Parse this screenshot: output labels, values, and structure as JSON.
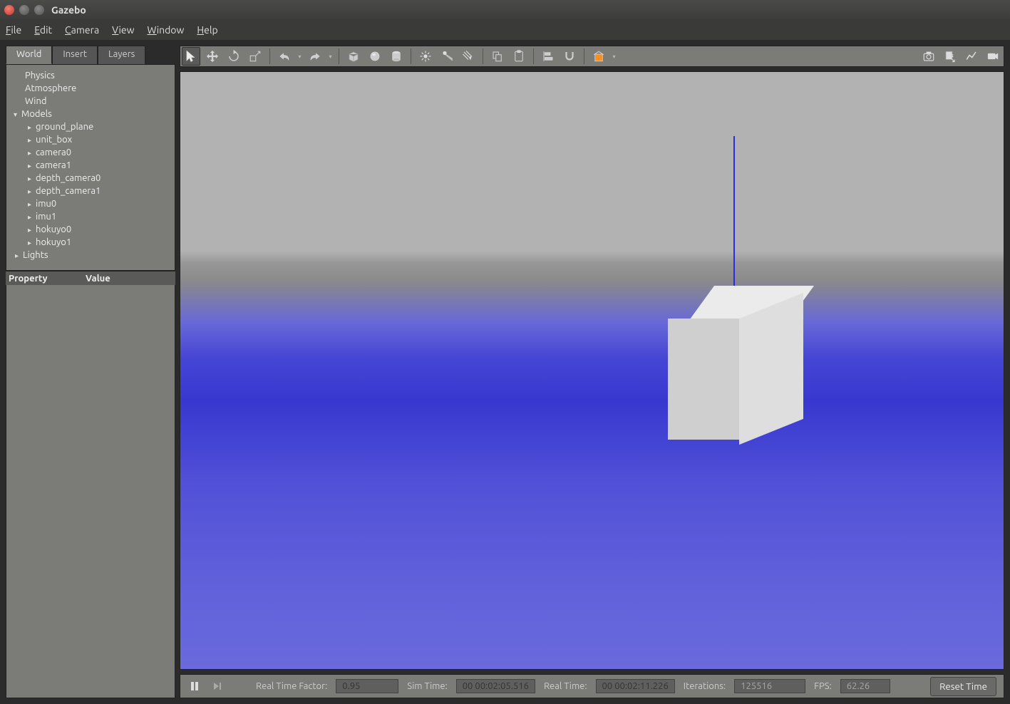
{
  "window": {
    "title": "Gazebo"
  },
  "menubar": {
    "file": "File",
    "edit": "Edit",
    "camera": "Camera",
    "view": "View",
    "window": "Window",
    "help": "Help"
  },
  "sidebar": {
    "tabs": {
      "world": "World",
      "insert": "Insert",
      "layers": "Layers"
    },
    "tree": {
      "physics": "Physics",
      "atmosphere": "Atmosphere",
      "wind": "Wind",
      "models": "Models",
      "model_items": [
        "ground_plane",
        "unit_box",
        "camera0",
        "camera1",
        "depth_camera0",
        "depth_camera1",
        "imu0",
        "imu1",
        "hokuyo0",
        "hokuyo1"
      ],
      "lights": "Lights"
    },
    "prop_header": {
      "property": "Property",
      "value": "Value"
    }
  },
  "status": {
    "rtf_label": "Real Time Factor:",
    "rtf_value": "0.95",
    "sim_time_label": "Sim Time:",
    "sim_time_value": "00 00:02:05.516",
    "real_time_label": "Real Time:",
    "real_time_value": "00 00:02:11.226",
    "iterations_label": "Iterations:",
    "iterations_value": "125516",
    "fps_label": "FPS:",
    "fps_value": "62.26",
    "reset": "Reset Time"
  },
  "toolbar_icons": {
    "select": "select",
    "translate": "translate",
    "rotate": "rotate",
    "scale": "scale",
    "undo": "undo",
    "redo": "redo",
    "box": "box",
    "sphere": "sphere",
    "cylinder": "cylinder",
    "point_light": "point-light",
    "spot_light": "spot-light",
    "directional_light": "directional-light",
    "copy": "copy",
    "paste": "paste",
    "align": "align",
    "snap": "snap",
    "building": "building",
    "screenshot": "screenshot",
    "log": "log",
    "plot": "plot",
    "record": "record"
  }
}
